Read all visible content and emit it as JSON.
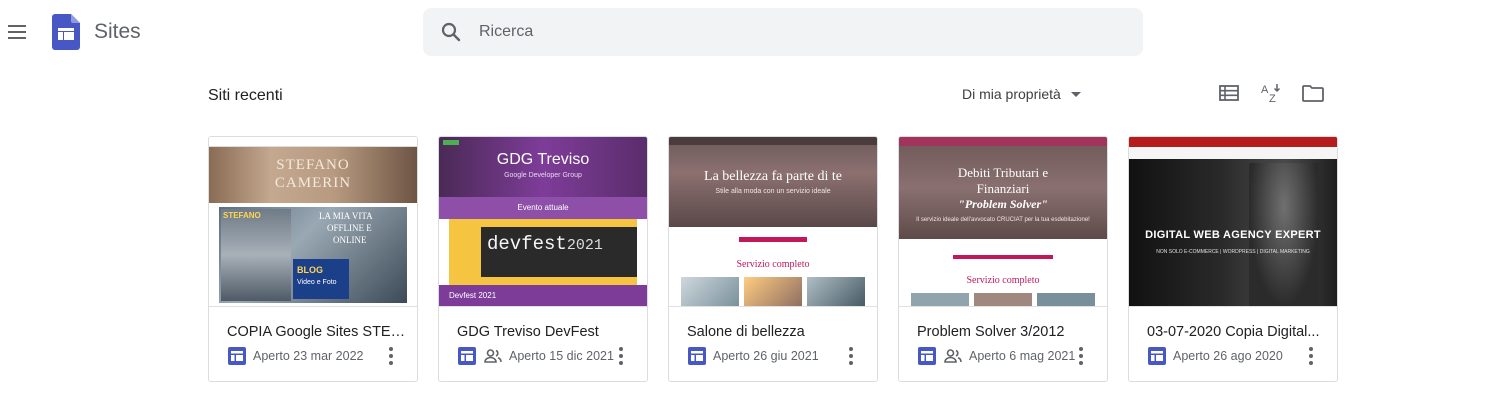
{
  "header": {
    "app_title": "Sites",
    "menu_icon": "hamburger-menu-icon",
    "logo_icon": "google-sites-logo",
    "search": {
      "placeholder": "Ricerca",
      "value": "",
      "icon": "search-icon"
    }
  },
  "toolbar": {
    "section_title": "Siti recenti",
    "owner_filter": "Di mia proprietà",
    "view_icon": "list-view-icon",
    "sort_icon": "sort-az-icon",
    "folder_icon": "folder-icon"
  },
  "colors": {
    "sites_blue": "#4758c5",
    "accent_purple": "#7e3c99",
    "dark_red": "#b71c1c"
  },
  "sites": [
    {
      "title": "COPIA Google Sites STEF...",
      "opened": "Aperto 23 mar 2022",
      "shared": false,
      "thumb": {
        "heading_line1": "STEFANO",
        "heading_line2": "CAMERIN",
        "overlay1": "LA MIA VITA",
        "overlay2": "OFFLINE E",
        "overlay3": "ONLINE",
        "badge1": "BLOG",
        "badge2": "Video e Foto",
        "badge3": "STEFANO"
      }
    },
    {
      "title": "GDG Treviso DevFest",
      "opened": "Aperto 15 dic 2021",
      "shared": true,
      "thumb": {
        "heading": "GDG Treviso",
        "subheading": "Google Developer Group",
        "band": "Evento attuale",
        "devfest": "devfest",
        "year": "2021",
        "footer": "Devfest 2021"
      }
    },
    {
      "title": "Salone di bellezza",
      "opened": "Aperto 26 giu 2021",
      "shared": false,
      "thumb": {
        "heading": "La bellezza fa parte di te",
        "subheading": "Stile alla moda con un servizio ideale",
        "section": "Servizio completo"
      }
    },
    {
      "title": "Problem Solver 3/2012",
      "opened": "Aperto 6 mag 2021",
      "shared": true,
      "thumb": {
        "heading_line1": "Debiti Tributari e",
        "heading_line2": "Finanziari",
        "heading_line3": "\"Problem Solver\"",
        "subheading": "Il servizio ideale dell'avvocato CRUCIAT per la tua esdebitazione!",
        "section": "Servizio completo"
      }
    },
    {
      "title": "03-07-2020 Copia Digital...",
      "opened": "Aperto 26 ago 2020",
      "shared": false,
      "thumb": {
        "heading": "DIGITAL WEB AGENCY EXPERT",
        "subheading": "NON SOLO E-COMMERCE | WORDPRESS | DIGITAL MARKETING"
      }
    }
  ]
}
